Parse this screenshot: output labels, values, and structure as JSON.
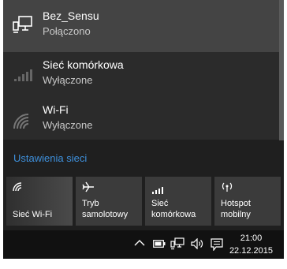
{
  "connections": [
    {
      "name": "Bez_Sensu",
      "status": "Połączono",
      "icon": "ethernet-icon"
    },
    {
      "name": "Sieć komórkowa",
      "status": "Wyłączone",
      "icon": "cellular-signal-icon"
    },
    {
      "name": "Wi-Fi",
      "status": "Wyłączone",
      "icon": "wifi-icon"
    }
  ],
  "settings_link": "Ustawienia sieci",
  "tiles": [
    {
      "line1": "",
      "line2": "Sieć Wi-Fi",
      "icon": "wifi-icon"
    },
    {
      "line1": "Tryb",
      "line2": "samolotowy",
      "icon": "airplane-icon"
    },
    {
      "line1": "Sieć",
      "line2": "komórkowa",
      "icon": "cellular-signal-icon"
    },
    {
      "line1": "Hotspot",
      "line2": "mobilny",
      "icon": "hotspot-icon"
    }
  ],
  "taskbar": {
    "time": "21:00",
    "date": "22.12.2015",
    "tray_icons": [
      "chevron-up-icon",
      "battery-icon",
      "network-icon",
      "volume-icon",
      "action-center-icon"
    ]
  },
  "colors": {
    "flyout_bg": "#1f1f1f",
    "active_row": "#444444",
    "link": "#3e8fda",
    "tile_bg": "#3b3b3b",
    "taskbar_bg": "#111111"
  }
}
